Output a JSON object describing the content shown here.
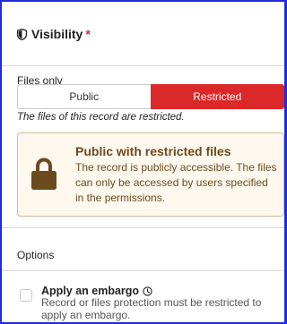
{
  "header": {
    "title": "Visibility",
    "required_marker": "*"
  },
  "files": {
    "label": "Files only",
    "options": [
      "Public",
      "Restricted"
    ],
    "selected": "Restricted",
    "note": "The files of this record are restricted."
  },
  "notice": {
    "title": "Public with restricted files",
    "body": "The record is publicly accessible. The files can only be accessed by users specified in the permissions."
  },
  "options": {
    "label": "Options"
  },
  "embargo": {
    "title": "Apply an embargo",
    "description": "Record or files protection must be restricted to apply an embargo.",
    "checked": false
  },
  "colors": {
    "accent_border": "#1f2bdc",
    "restricted": "#db2828",
    "notice_bg": "#fff8ef",
    "notice_text": "#6b4a1e"
  }
}
